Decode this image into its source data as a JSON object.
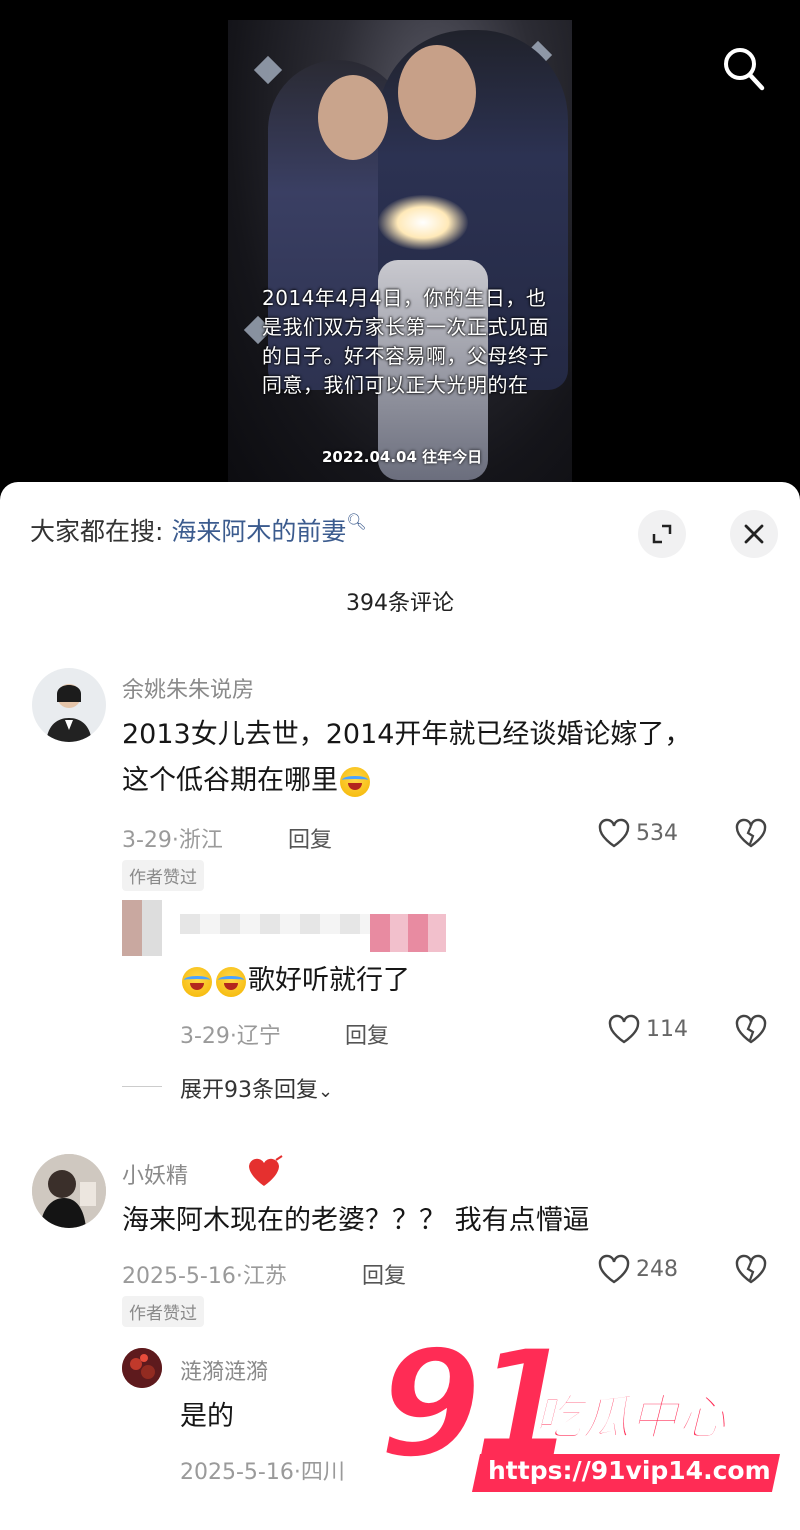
{
  "video": {
    "caption": "2014年4月4日，你的生日，也是我们双方家长第一次正式见面的日子。好不容易啊，父母终于同意，我们可以正大光明的在",
    "date_watermark": "2022.04.04 往年今日"
  },
  "sheet": {
    "search_prefix": "大家都在搜:",
    "search_query": "海来阿木的前妻",
    "comment_count": "394条评论"
  },
  "comments": [
    {
      "username": "余姚朱朱说房",
      "text_line1": "2013女儿去世，2014开年就已经谈婚论嫁了，",
      "text_line2": "这个低谷期在哪里",
      "date_location": "3-29·浙江",
      "reply_label": "回复",
      "likes": "534",
      "author_tag": "作者赞过",
      "reply": {
        "text": "歌好听就行了",
        "date_location": "3-29·辽宁",
        "reply_label": "回复",
        "likes": "114"
      },
      "expand_label": "展开93条回复"
    },
    {
      "username": "小妖精",
      "text": "海来阿木现在的老婆？？？ 我有点懵逼",
      "date_location": "2025-5-16·江苏",
      "reply_label": "回复",
      "likes": "248",
      "author_tag": "作者赞过",
      "reply": {
        "username": "涟漪涟漪",
        "text": "是的",
        "date_location": "2025-5-16·四川"
      }
    }
  ],
  "watermark": {
    "number": "91",
    "name": "吃瓜中心",
    "url": "https://91vip14.com"
  },
  "colors": {
    "brand_red": "#ff2c55",
    "search_link": "#3b5b8e"
  }
}
